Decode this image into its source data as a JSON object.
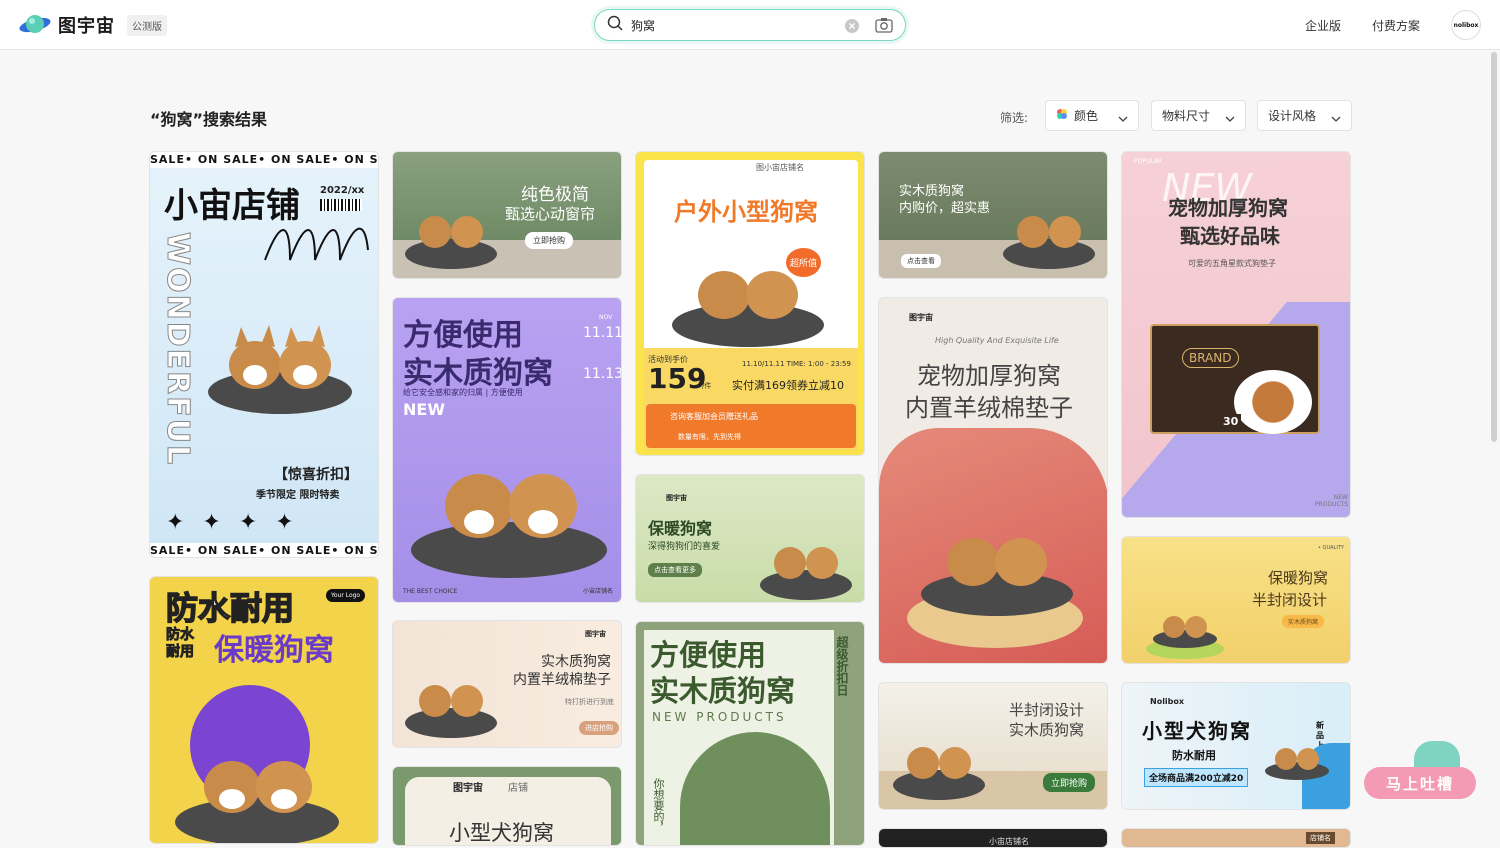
{
  "header": {
    "brand": "图宇宙",
    "beta_badge": "公测版",
    "search_value": "狗窝",
    "nav": [
      "企业版",
      "付费方案"
    ],
    "avatar_text": "nolibox"
  },
  "results": {
    "title": "“狗窝”搜索结果",
    "filter_label": "筛选:",
    "filters": [
      "颜色",
      "物料尺寸",
      "设计风格"
    ]
  },
  "cards": {
    "c1": {
      "ticker": "SALE• ON  SALE• ON  SALE• ON  SA",
      "title": "小宙店铺",
      "date": "2022/xx",
      "vertical": "WONDERFUL",
      "promo": "【惊喜折扣】",
      "sub": "季节限定  限时特卖"
    },
    "c2": {
      "line1": "纯色极简",
      "line2": "甄选心动窗帘",
      "button": "立即抢购"
    },
    "c3": {
      "line1": "方便使用",
      "line2": "实木质狗窝",
      "date1": "11.11",
      "date2": "11.13",
      "month": "NOV",
      "sub": "给它安全感和家的归属 | 方便使用",
      "new": "NEW",
      "footer": "THE BEST CHOICE",
      "store": "小宙店铺名"
    },
    "c4": {
      "store": "图小宙店铺名",
      "title": "户外小型狗窝",
      "badge": "超所值",
      "price_label": "活动到手价",
      "price": "159",
      "unit": "/件",
      "time": "11.10/11.11   TIME: 1:00 - 23:59",
      "coupon": "实付满169领券立减10",
      "consult": "咨询客服加会员赠送礼品",
      "limit": "数量有限，先到先得"
    },
    "c5": {
      "line1": "实木质狗窝",
      "line2": "内购价，超实惠",
      "button": "点击查看"
    },
    "c6": {
      "tag": "POPULAR",
      "bg": "NEW",
      "line1": "宠物加厚狗窝",
      "line2": "甄选好品味",
      "sub": "可爱的五角星款式狗垫子",
      "brand": "BRAND",
      "num": "30",
      "corner": "NEW PRODUCTS"
    },
    "c7": {
      "brand": "图宇宙",
      "line1": "保暖狗窝",
      "line2": "深得狗狗们的喜爱",
      "button": "点击查看更多"
    },
    "c8": {
      "brand": "图宇宙",
      "en": "High Quality And Exquisite Life",
      "line1": "宠物加厚狗窝",
      "line2": "内置羊绒棉垫子"
    },
    "c9": {
      "line1": "保暖狗窝",
      "line2": "半封闭设计",
      "tag": "• QUALITY",
      "badge": "实木质狗窝"
    },
    "c10": {
      "line1": "防水耐用",
      "logo": "Your Logo",
      "small": "防水\n耐用",
      "line2": "保暖狗窝"
    },
    "c11": {
      "brand": "图宇宙",
      "line1": "实木质狗窝",
      "line2": "内置羊绒棉垫子",
      "sub": "特打折进行到底",
      "button": "进店抢购"
    },
    "c12": {
      "line1": "方便使用",
      "line2": "实木质狗窝",
      "en": "NEW PRODUCTS",
      "vertical": "超级折扣日",
      "vertical2": "你想要的，"
    },
    "c13": {
      "line1": "半封闭设计",
      "line2": "实木质狗窝",
      "button": "立即抢购"
    },
    "c14": {
      "brand": "Nolibox",
      "title": "小型犬狗窝",
      "sub": "防水耐用",
      "promo": "全场商品满200立减20",
      "badge": "新品上市"
    },
    "c15": {
      "brand": "图宇宙",
      "store": "店铺",
      "title": "小型犬狗窝"
    },
    "c16": {
      "store": "小宙店铺名"
    },
    "c17": {
      "store": "店铺名"
    }
  },
  "feedback": "马上吐槽"
}
